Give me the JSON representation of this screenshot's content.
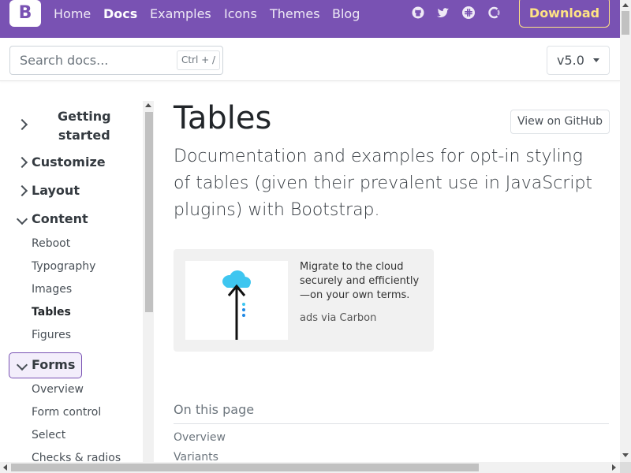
{
  "navbar": {
    "brand": "B",
    "links": [
      {
        "label": "Home"
      },
      {
        "label": "Docs"
      },
      {
        "label": "Examples"
      },
      {
        "label": "Icons"
      },
      {
        "label": "Themes"
      },
      {
        "label": "Blog"
      }
    ],
    "icons": [
      "github-icon",
      "twitter-icon",
      "slack-icon",
      "opencollective-icon"
    ],
    "download_label": "Download",
    "bg_color": "#7952b3",
    "download_color": "#ffe484"
  },
  "subbar": {
    "search_placeholder": "Search docs...",
    "search_shortcut": "Ctrl + /",
    "version": "v5.0"
  },
  "sidebar": {
    "groups": [
      {
        "label": "Getting started",
        "label_line1": "Getting",
        "label_line2": "started",
        "expanded": false
      },
      {
        "label": "Customize",
        "expanded": false
      },
      {
        "label": "Layout",
        "expanded": false
      },
      {
        "label": "Content",
        "expanded": true,
        "items": [
          "Reboot",
          "Typography",
          "Images",
          "Tables",
          "Figures"
        ]
      },
      {
        "label": "Forms",
        "expanded": true,
        "items": [
          "Overview",
          "Form control",
          "Select",
          "Checks & radios"
        ]
      }
    ],
    "active_item": "Tables"
  },
  "main": {
    "title": "Tables",
    "github_label": "View on GitHub",
    "lead_lines": [
      "Documentation and examples for opt-in styling",
      "of tables (given their prevalent use in JavaScript",
      "plugins) with Bootstrap."
    ],
    "ad": {
      "text_lines": [
        "Migrate to the cloud",
        "securely and efficiently",
        "—on your own terms."
      ],
      "credit": "ads via Carbon"
    },
    "toc": {
      "title": "On this page",
      "links": [
        "Overview",
        "Variants"
      ]
    }
  }
}
